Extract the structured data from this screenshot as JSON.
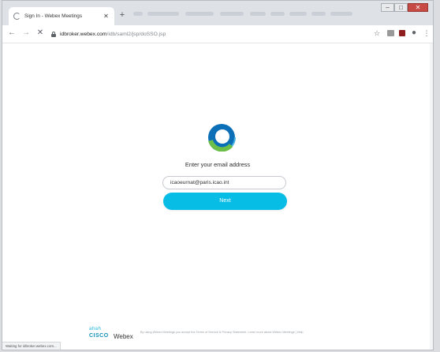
{
  "browser": {
    "tab_title": "Sign In - Webex Meetings",
    "url_host": "idbroker.webex.com",
    "url_path": "/idb/saml2/jsp/doSSO.jsp",
    "status_text": "Waiting for idbroker.webex.com..."
  },
  "page": {
    "prompt": "Enter your email address",
    "email_value": "icaoeurnat@paris.icao.int",
    "next_label": "Next"
  },
  "footer": {
    "cisco_bars": "ahah",
    "cisco_word": "CISCO",
    "webex_word": "Webex",
    "legal_text": "By using Webex Meetings you accept the Terms of Service & Privacy Statement. Learn more about Webex Meetings | Help"
  },
  "colors": {
    "next_button": "#07bde6",
    "logo_green": "#6cc04a",
    "logo_blue": "#0a6fb7",
    "cisco_blue": "#0f8fb8"
  },
  "icons": [
    "reload-spinner-icon",
    "close-icon",
    "new-tab-icon",
    "back-icon",
    "forward-icon",
    "stop-icon",
    "lock-icon",
    "star-icon",
    "account-icon",
    "menu-icon",
    "webex-logo-icon"
  ]
}
